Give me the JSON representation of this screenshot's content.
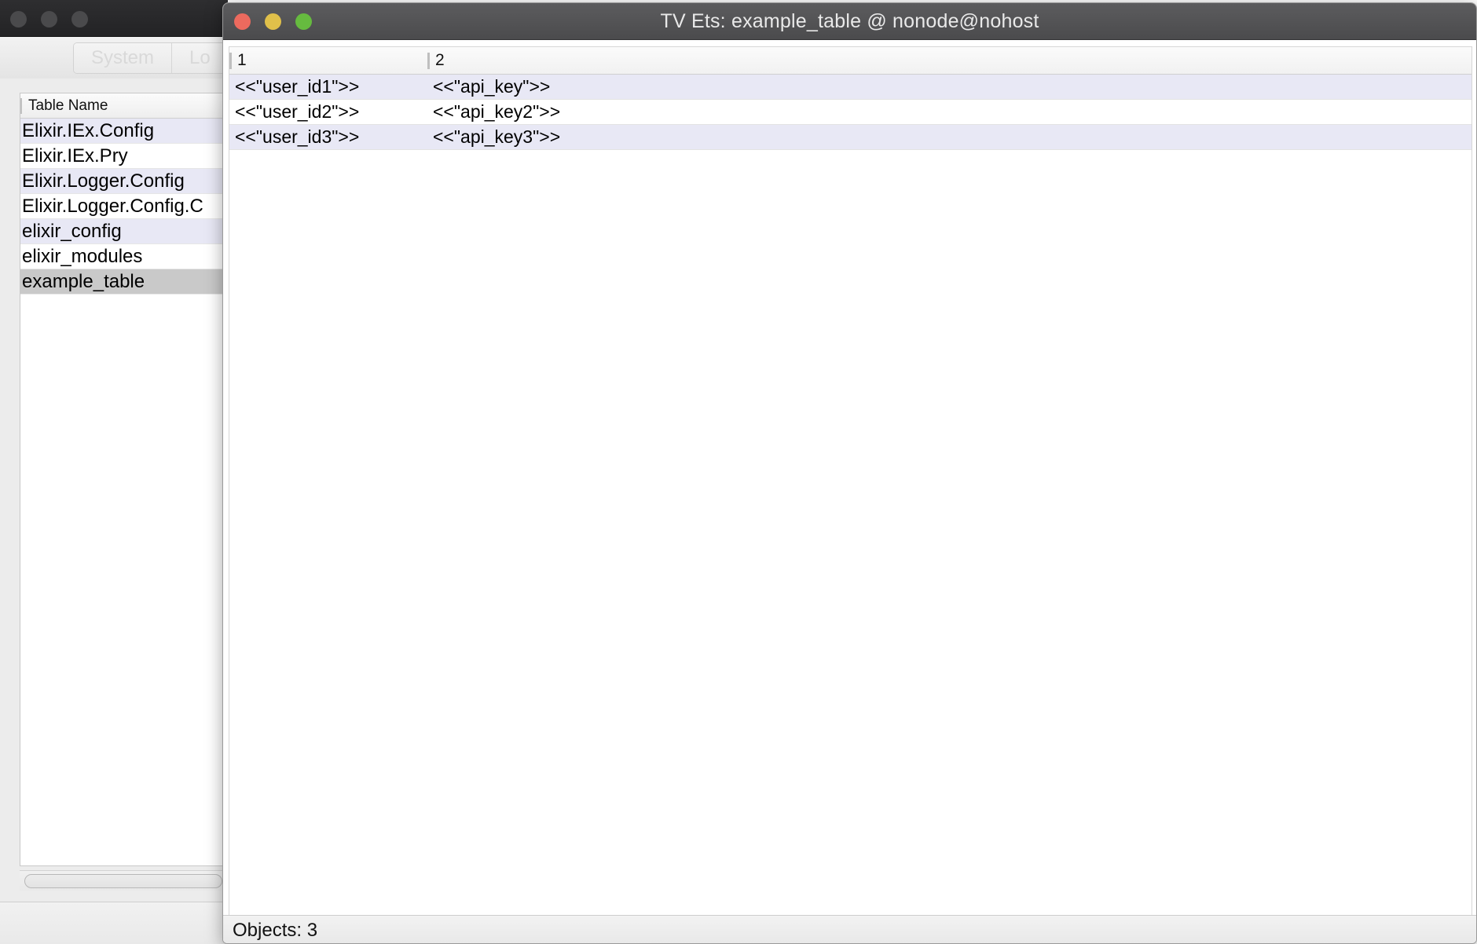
{
  "background_window": {
    "traffic_lights": [
      "close",
      "minimize",
      "maximize"
    ],
    "tabs": [
      {
        "label": "System",
        "active": true
      },
      {
        "label": "Lo",
        "active": false
      }
    ],
    "table_list": {
      "header": "Table Name",
      "rows": [
        {
          "name": "Elixir.IEx.Config",
          "selected": false
        },
        {
          "name": "Elixir.IEx.Pry",
          "selected": false
        },
        {
          "name": "Elixir.Logger.Config",
          "selected": false
        },
        {
          "name": "Elixir.Logger.Config.C",
          "selected": false
        },
        {
          "name": "elixir_config",
          "selected": false
        },
        {
          "name": "elixir_modules",
          "selected": false
        },
        {
          "name": "example_table",
          "selected": true
        }
      ]
    }
  },
  "foreground_window": {
    "title": "TV Ets: example_table @ nonode@nohost",
    "traffic_lights": [
      "close",
      "minimize",
      "maximize"
    ],
    "grid": {
      "columns": [
        "1",
        "2"
      ],
      "rows": [
        [
          "<<\"user_id1\">>",
          "<<\"api_key\">>"
        ],
        [
          "<<\"user_id2\">>",
          "<<\"api_key2\">>"
        ],
        [
          "<<\"user_id3\">>",
          "<<\"api_key3\">>"
        ]
      ]
    },
    "status": "Objects: 3"
  },
  "colors": {
    "active_titlebar": "#5c5c5e",
    "inactive_titlebar": "#2e2e30",
    "row_stripe": "#e8e8f5",
    "selected_row": "#c9c9c9",
    "light_close": "#ec6a5e",
    "light_min": "#e0c04a",
    "light_max": "#66bb3f"
  }
}
